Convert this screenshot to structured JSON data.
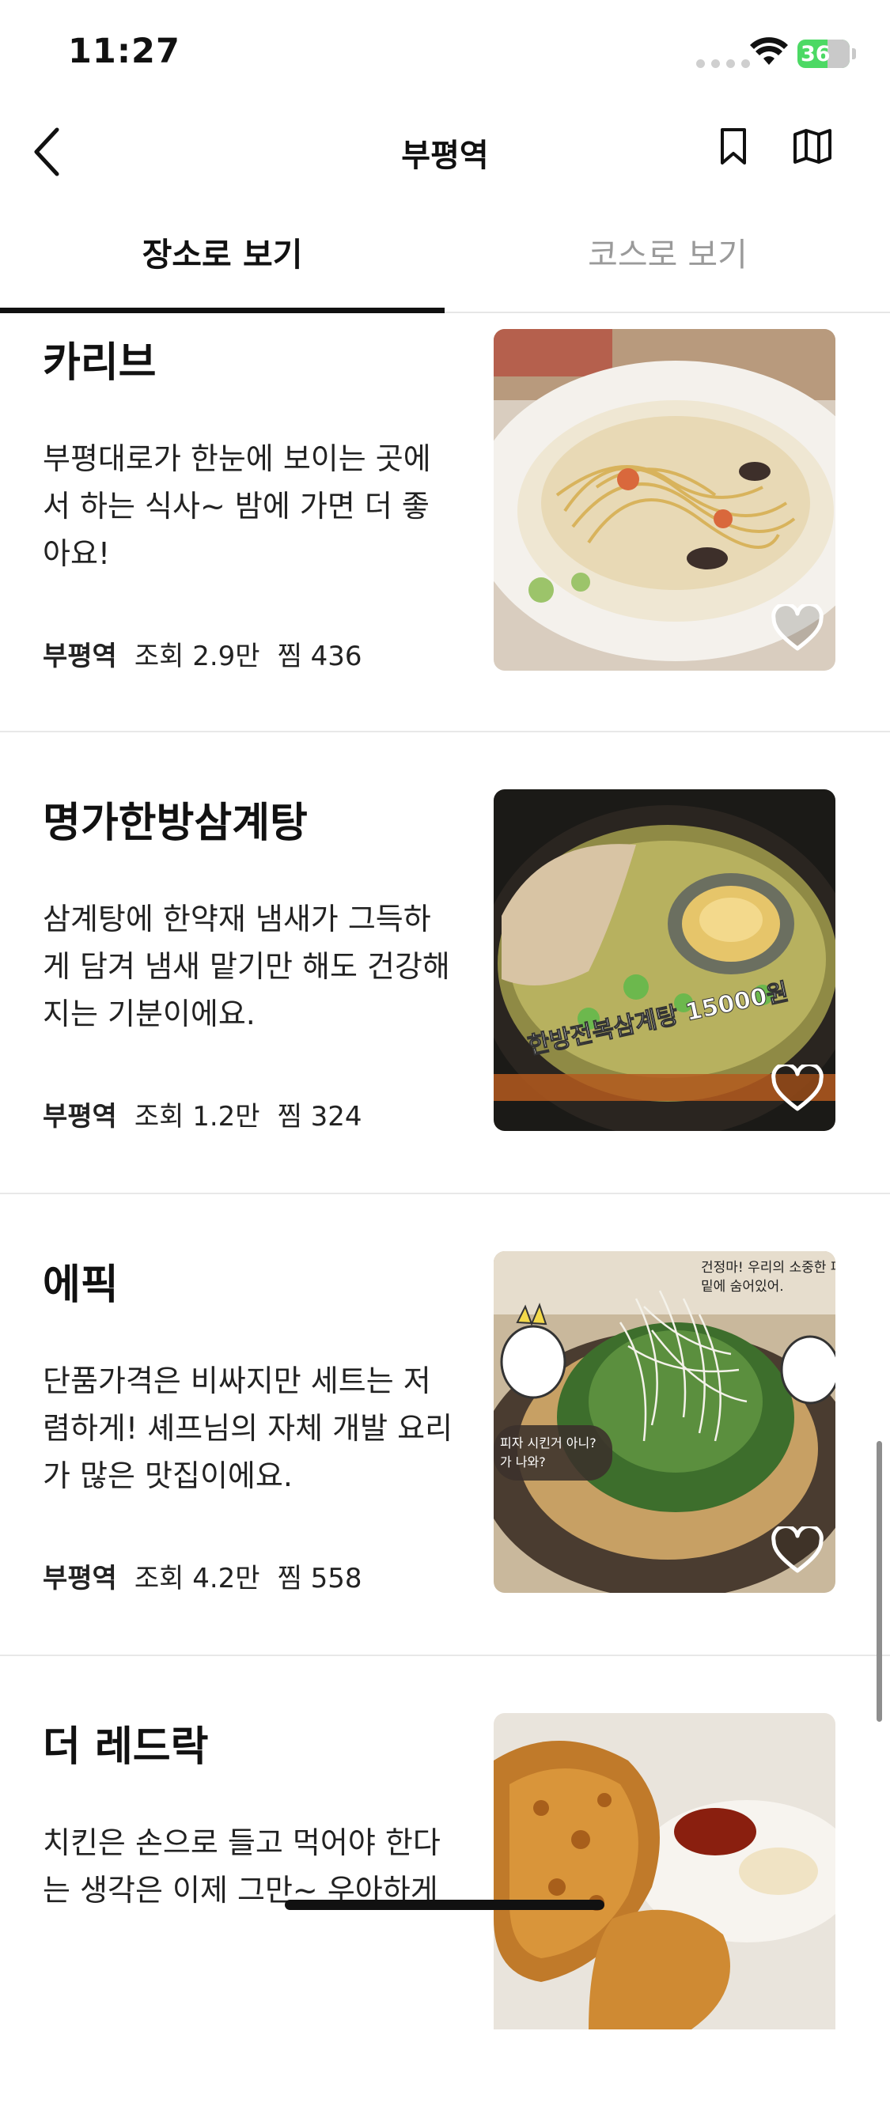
{
  "status": {
    "time": "11:27",
    "battery": "36"
  },
  "nav": {
    "title": "부평역",
    "back_icon": "chevron-left-icon",
    "bookmark_icon": "bookmark-icon",
    "map_icon": "map-icon"
  },
  "tabs": [
    {
      "label": "장소로 보기",
      "active": true
    },
    {
      "label": "코스로 보기",
      "active": false
    }
  ],
  "items": [
    {
      "name": "카리브",
      "desc": "부평대로가 한눈에 보이는 곳에서 하는 식사~ 밤에 가면 더 좋아요!",
      "station": "부평역",
      "views": "조회 2.9만",
      "likes": "찜 436",
      "image": "pasta-photo"
    },
    {
      "name": "명가한방삼계탕",
      "desc": "삼계탕에 한약재 냄새가 그득하게 담겨 냄새 맡기만 해도 건강해지는 기분이에요.",
      "station": "부평역",
      "views": "조회 1.2만",
      "likes": "찜 324",
      "image": "samgyetang-photo",
      "image_caption": "한방전복삼계탕 15000원"
    },
    {
      "name": "에픽",
      "desc": "단품가격은 비싸지만 세트는 저렴하게! 셰프님의 자체 개발 요리가 많은 맛집이에요.",
      "station": "부평역",
      "views": "조회 4.2만",
      "likes": "찜 558",
      "image": "pizza-photo",
      "image_caption_1": "건정마! 우리의 소중한 피",
      "image_caption_2": "밑에 숨어있어.",
      "image_caption_3": "피자 시킨거 아니?",
      "image_caption_4": "가 나와?"
    },
    {
      "name": "더 레드락",
      "desc": "치킨은 손으로 들고 먹어야 한다는 생각은 이제 그만~ 우아하게",
      "image": "fried-chicken-photo"
    }
  ],
  "colors": {
    "tab_underline": "#111111",
    "inactive_tab": "#9a9a9a",
    "divider": "#e8e8e8"
  }
}
